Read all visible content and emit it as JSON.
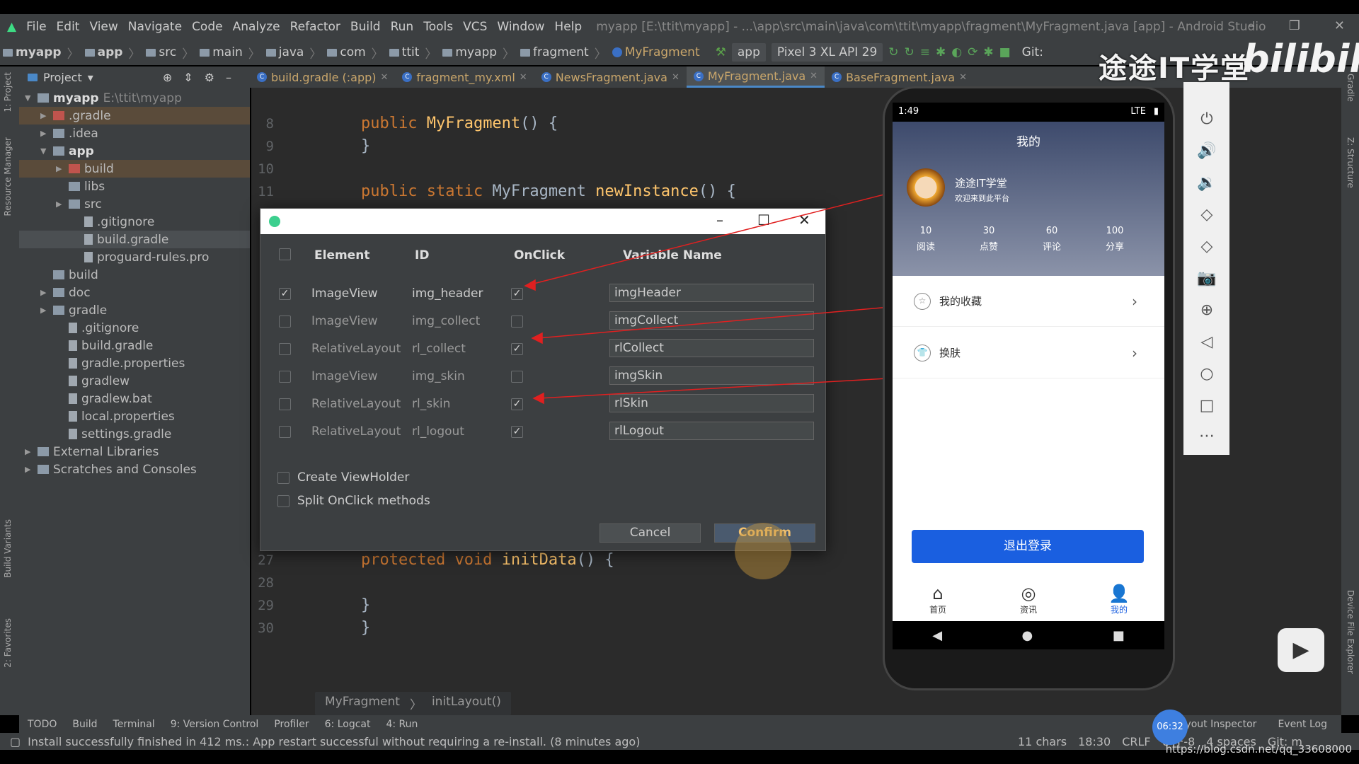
{
  "menu": {
    "items": [
      "File",
      "Edit",
      "View",
      "Navigate",
      "Code",
      "Analyze",
      "Refactor",
      "Build",
      "Run",
      "Tools",
      "VCS",
      "Window",
      "Help"
    ],
    "title": "myapp [E:\\ttit\\myapp] - ...\\app\\src\\main\\java\\com\\ttit\\myapp\\fragment\\MyFragment.java [app] - Android Studio"
  },
  "toolbar": {
    "breadcrumbs": [
      "myapp",
      "app",
      "src",
      "main",
      "java",
      "com",
      "ttit",
      "myapp",
      "fragment",
      "MyFragment"
    ],
    "run_config": "app",
    "device": "Pixel 3 XL API 29",
    "git": "Git:"
  },
  "tabs": {
    "project_label": "Project",
    "files": [
      {
        "label": "build.gradle (:app)"
      },
      {
        "label": "fragment_my.xml"
      },
      {
        "label": "NewsFragment.java"
      },
      {
        "label": "MyFragment.java",
        "active": true
      },
      {
        "label": "BaseFragment.java"
      }
    ]
  },
  "left_strip": [
    "1: Project",
    "Resource Manager",
    "Build Variants",
    "2: Favorites"
  ],
  "right_strip": [
    "Gradle",
    "Z: Structure",
    "Device File Explorer"
  ],
  "project_tree": [
    {
      "label": "myapp",
      "extra": "E:\\ttit\\myapp",
      "level": 0,
      "arrow": "▼",
      "bold": true
    },
    {
      "label": ".gradle",
      "level": 1,
      "arrow": "▶",
      "hl": true
    },
    {
      "label": ".idea",
      "level": 1,
      "arrow": "▶"
    },
    {
      "label": "app",
      "level": 1,
      "arrow": "▼",
      "bold": true
    },
    {
      "label": "build",
      "level": 2,
      "arrow": "▶",
      "hl": true
    },
    {
      "label": "libs",
      "level": 2,
      "arrow": ""
    },
    {
      "label": "src",
      "level": 2,
      "arrow": "▶"
    },
    {
      "label": ".gitignore",
      "level": 3,
      "arrow": "",
      "file": true
    },
    {
      "label": "build.gradle",
      "level": 3,
      "arrow": "",
      "file": true,
      "sel": true
    },
    {
      "label": "proguard-rules.pro",
      "level": 3,
      "arrow": "",
      "file": true
    },
    {
      "label": "build",
      "level": 1,
      "arrow": ""
    },
    {
      "label": "doc",
      "level": 1,
      "arrow": "▶"
    },
    {
      "label": "gradle",
      "level": 1,
      "arrow": "▶"
    },
    {
      "label": ".gitignore",
      "level": 2,
      "arrow": "",
      "file": true
    },
    {
      "label": "build.gradle",
      "level": 2,
      "arrow": "",
      "file": true
    },
    {
      "label": "gradle.properties",
      "level": 2,
      "arrow": "",
      "file": true
    },
    {
      "label": "gradlew",
      "level": 2,
      "arrow": "",
      "file": true
    },
    {
      "label": "gradlew.bat",
      "level": 2,
      "arrow": "",
      "file": true
    },
    {
      "label": "local.properties",
      "level": 2,
      "arrow": "",
      "file": true
    },
    {
      "label": "settings.gradle",
      "level": 2,
      "arrow": "",
      "file": true
    },
    {
      "label": "External Libraries",
      "level": 0,
      "arrow": "▶"
    },
    {
      "label": "Scratches and Consoles",
      "level": 0,
      "arrow": "▶"
    }
  ],
  "editor": {
    "lines_top": [
      {
        "n": "8",
        "kw": "public ",
        "fn": "MyFragment",
        "rest": "() {"
      },
      {
        "n": "9",
        "kw": "",
        "fn": "",
        "rest": "}"
      },
      {
        "n": "10",
        "kw": "",
        "fn": "",
        "rest": ""
      },
      {
        "n": "11",
        "kw": "public static ",
        "ty": "MyFragment ",
        "fn": "newInstance",
        "rest": "() {"
      }
    ],
    "lines_bottom": [
      {
        "n": "27",
        "kw": "protected void ",
        "fn": "initData",
        "rest": "() {"
      },
      {
        "n": "28",
        "kw": "",
        "fn": "",
        "rest": ""
      },
      {
        "n": "29",
        "kw": "",
        "fn": "",
        "rest": "}"
      },
      {
        "n": "30",
        "kw": "",
        "fn": "",
        "rest": "}"
      }
    ],
    "breadcrumb": [
      "MyFragment",
      "initLayout()"
    ]
  },
  "dialog": {
    "headers": {
      "element": "Element",
      "id": "ID",
      "onclick": "OnClick",
      "variable": "Variable Name"
    },
    "rows": [
      {
        "selected": true,
        "element": "ImageView",
        "id": "img_header",
        "onclick": true,
        "variable": "imgHeader"
      },
      {
        "selected": false,
        "element": "ImageView",
        "id": "img_collect",
        "onclick": false,
        "variable": "imgCollect"
      },
      {
        "selected": false,
        "element": "RelativeLayout",
        "id": "rl_collect",
        "onclick": true,
        "variable": "rlCollect"
      },
      {
        "selected": false,
        "element": "ImageView",
        "id": "img_skin",
        "onclick": false,
        "variable": "imgSkin"
      },
      {
        "selected": false,
        "element": "RelativeLayout",
        "id": "rl_skin",
        "onclick": true,
        "variable": "rlSkin"
      },
      {
        "selected": false,
        "element": "RelativeLayout",
        "id": "rl_logout",
        "onclick": true,
        "variable": "rlLogout"
      }
    ],
    "options": [
      {
        "label": "Create ViewHolder",
        "checked": false
      },
      {
        "label": "Split OnClick methods",
        "checked": false
      }
    ],
    "cancel": "Cancel",
    "confirm": "Confirm"
  },
  "phone": {
    "time": "1:49",
    "network": "LTE",
    "title": "我的",
    "user_name": "途途IT学堂",
    "user_subtitle": "欢迎来到此平台",
    "stats": [
      {
        "value": "10",
        "label": "阅读"
      },
      {
        "value": "30",
        "label": "点赞"
      },
      {
        "value": "60",
        "label": "评论"
      },
      {
        "value": "100",
        "label": "分享"
      }
    ],
    "menu": [
      {
        "label": "我的收藏",
        "icon": "star-icon"
      },
      {
        "label": "换肤",
        "icon": "shirt-icon"
      }
    ],
    "logout": "退出登录",
    "nav": [
      {
        "label": "首页",
        "icon": "home-icon"
      },
      {
        "label": "资讯",
        "icon": "compass-icon"
      },
      {
        "label": "我的",
        "icon": "user-icon",
        "active": true
      }
    ],
    "accent": "#1a5fe0"
  },
  "tool_windows": {
    "left": [
      "TODO",
      "Build",
      "Terminal",
      "9: Version Control",
      "Profiler",
      "6: Logcat",
      "4: Run"
    ],
    "right": [
      "Layout Inspector",
      "Event Log"
    ]
  },
  "status": {
    "message": "Install successfully finished in 412 ms.: App restart successful without requiring a re-install. (8 minutes ago)",
    "right": [
      "11 chars",
      "18:30",
      "CRLF",
      "UTF-8",
      "4 spaces",
      "Git: m"
    ]
  },
  "overlay": {
    "watermark": "途途IT学堂",
    "brand": "bilibili",
    "url": "https://blog.csdn.net/qq_33608000",
    "clock": "06:32"
  }
}
